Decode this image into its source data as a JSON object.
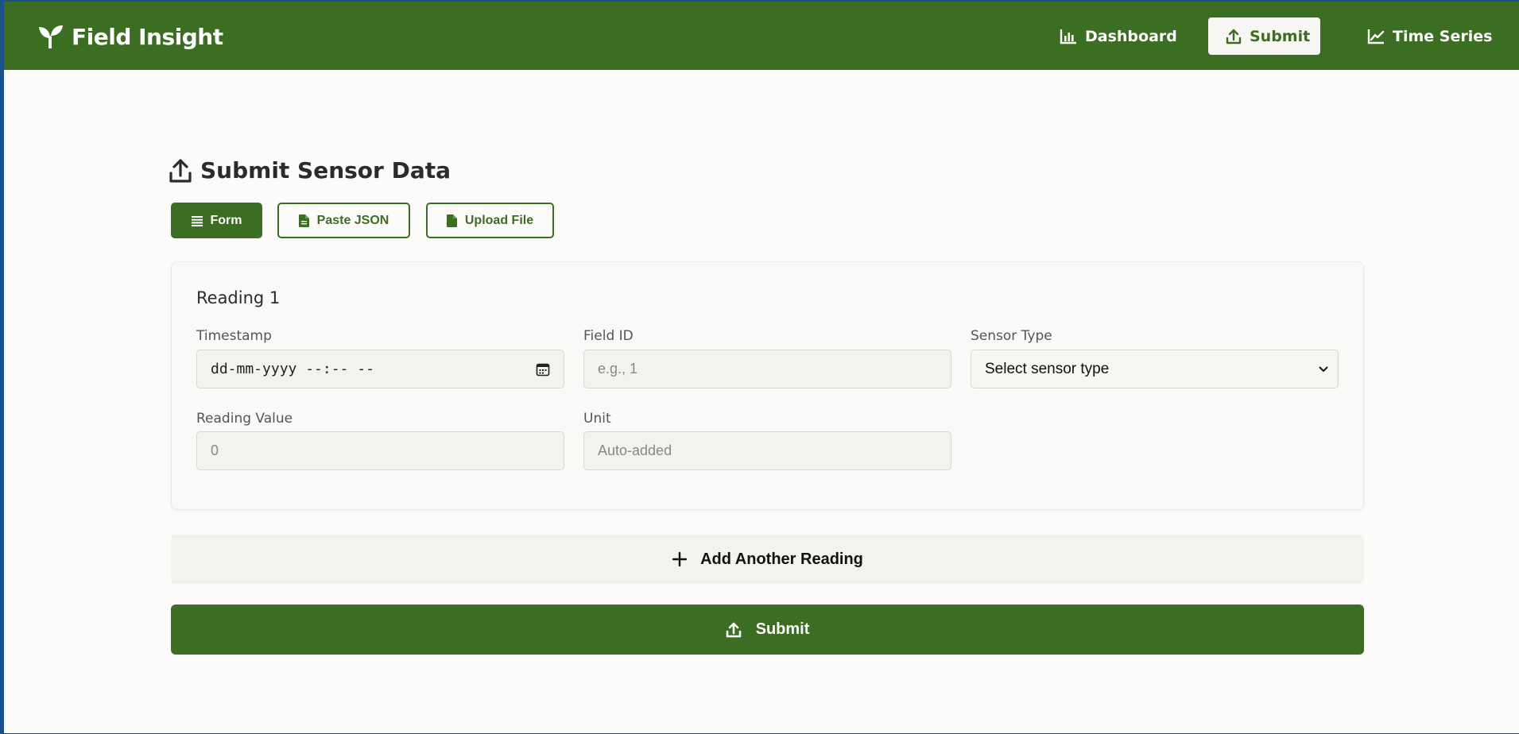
{
  "app": {
    "title": "Field Insight",
    "logo_icon": "sprout-icon"
  },
  "colors": {
    "brand_green": "#3b6d22",
    "page_bg": "#fcfbf9",
    "nav_active_bg": "#f7f6f3"
  },
  "nav": {
    "items": [
      {
        "label": "Dashboard",
        "icon": "bar-chart-icon",
        "active": false
      },
      {
        "label": "Submit",
        "icon": "upload-icon",
        "active": true
      },
      {
        "label": "Time Series",
        "icon": "line-chart-icon",
        "active": false
      }
    ]
  },
  "page": {
    "title": "Submit Sensor Data",
    "icon": "upload-icon"
  },
  "mode_tabs": [
    {
      "label": "Form",
      "icon": "list-icon",
      "active": true
    },
    {
      "label": "Paste JSON",
      "icon": "document-icon",
      "active": false
    },
    {
      "label": "Upload File",
      "icon": "document-icon",
      "active": false
    }
  ],
  "reading": {
    "title": "Reading 1",
    "timestamp": {
      "label": "Timestamp",
      "value": "dd-mm-yyyy --:-- --",
      "icon": "calendar-icon"
    },
    "field_id": {
      "label": "Field ID",
      "placeholder": "e.g., 1"
    },
    "sensor_type": {
      "label": "Sensor Type",
      "selected": "Select sensor type"
    },
    "reading_value": {
      "label": "Reading Value",
      "placeholder": "0"
    },
    "unit": {
      "label": "Unit",
      "placeholder": "Auto-added"
    }
  },
  "actions": {
    "add_reading": "Add Another Reading",
    "submit": "Submit"
  }
}
